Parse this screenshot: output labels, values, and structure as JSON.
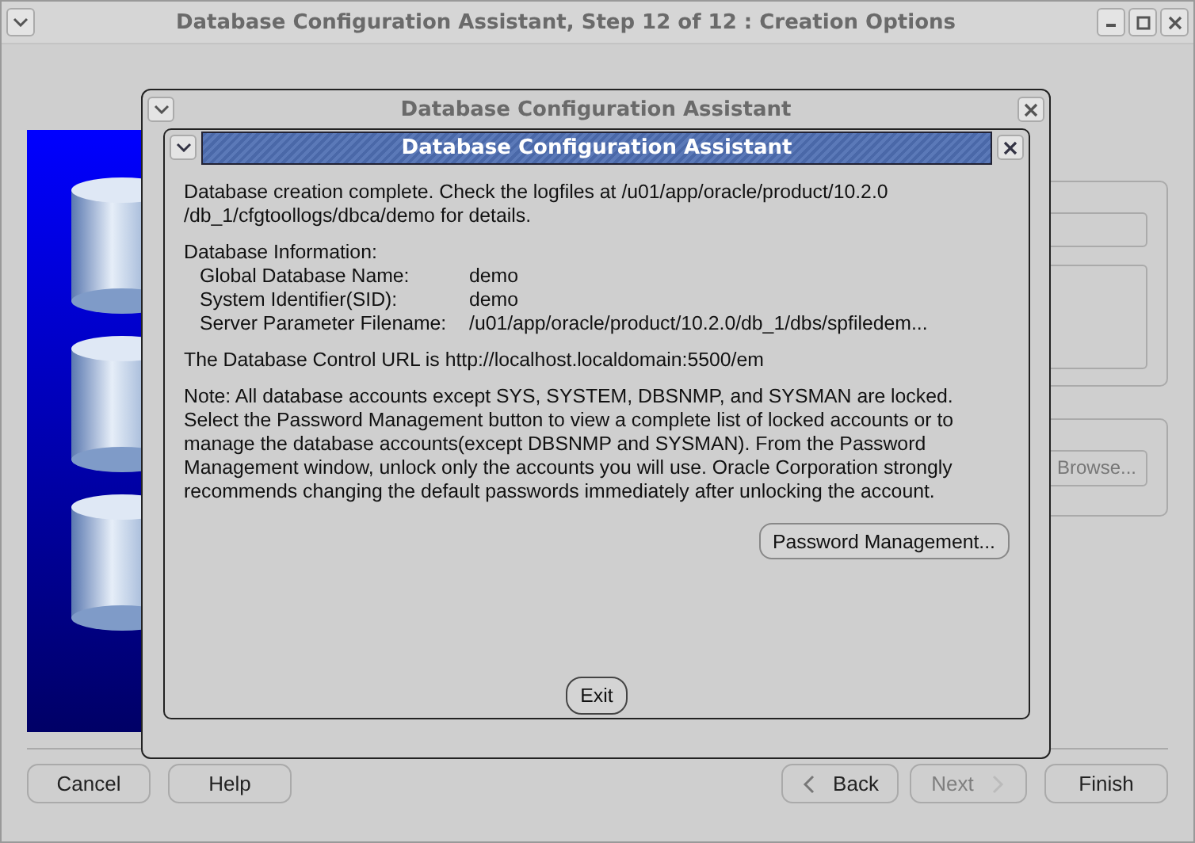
{
  "window": {
    "title": "Database Configuration Assistant, Step 12 of 12 : Creation Options",
    "browse_button": "Browse...",
    "buttons": [
      {
        "label": "Cancel",
        "kind": "plain",
        "disabled": false
      },
      {
        "label": "Help",
        "kind": "plain",
        "disabled": false
      },
      {
        "label": "Back",
        "kind": "back",
        "disabled": false
      },
      {
        "label": "Next",
        "kind": "next",
        "disabled": true
      },
      {
        "label": "Finish",
        "kind": "plain",
        "disabled": false
      }
    ]
  },
  "dialog": {
    "title": "Database Configuration Assistant",
    "inner_title": "Database Configuration Assistant",
    "message": [
      "Database creation complete. Check the logfiles at /u01/app/oracle/product/10.2.0",
      "/db_1/cfgtoollogs/dbca/demo for details."
    ],
    "info_heading": "Database Information:",
    "info": [
      {
        "label": "Global Database Name:",
        "value": "demo"
      },
      {
        "label": "System Identifier(SID):",
        "value": "demo"
      },
      {
        "label": "Server Parameter Filename:",
        "value": "/u01/app/oracle/product/10.2.0/db_1/dbs/spfiledem..."
      }
    ],
    "url_text": "The Database Control URL is http://localhost.localdomain:5500/em",
    "note": [
      "Note: All database accounts except SYS, SYSTEM, DBSNMP, and SYSMAN are locked.",
      "Select the Password Management button to view a complete list of locked accounts or to",
      "manage the database accounts(except DBSNMP and SYSMAN). From the Password",
      "Management window, unlock only the accounts you will use. Oracle Corporation strongly",
      "recommends changing the default passwords immediately after unlocking the account."
    ],
    "password_button": "Password Management...",
    "exit_button": "Exit"
  }
}
